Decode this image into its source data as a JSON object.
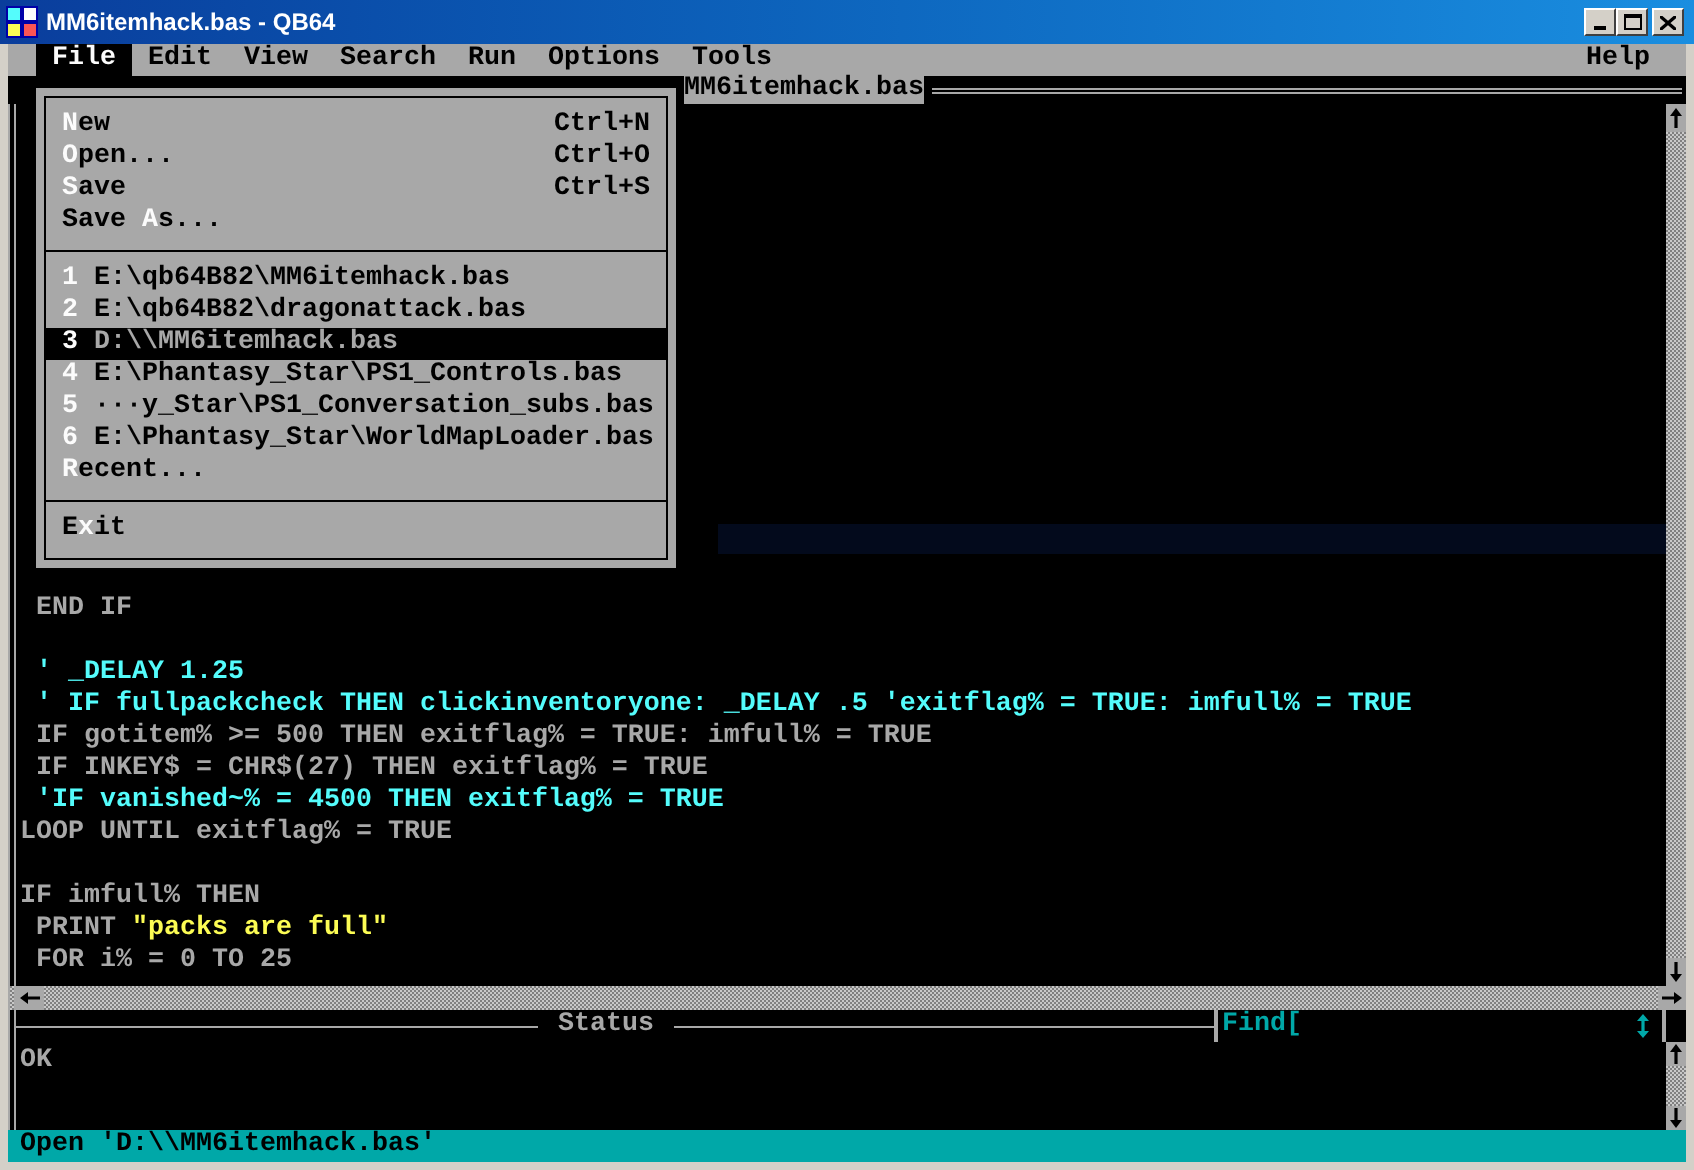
{
  "window": {
    "title": "MM6itemhack.bas - QB64"
  },
  "menu_bar": [
    {
      "label": "File",
      "selected": true
    },
    {
      "label": "Edit",
      "selected": false
    },
    {
      "label": "View",
      "selected": false
    },
    {
      "label": "Search",
      "selected": false
    },
    {
      "label": "Run",
      "selected": false
    },
    {
      "label": "Options",
      "selected": false
    },
    {
      "label": "Tools",
      "selected": false
    },
    {
      "label": "Help",
      "selected": false
    }
  ],
  "file_menu": {
    "sections": [
      {
        "items": [
          {
            "hotkey": "N",
            "rest": "ew",
            "shortcut": "Ctrl+N",
            "selected": false
          },
          {
            "hotkey": "O",
            "rest": "pen...",
            "shortcut": "Ctrl+O",
            "selected": false
          },
          {
            "hotkey": "S",
            "rest": "ave",
            "shortcut": "Ctrl+S",
            "selected": false
          },
          {
            "before": "Save ",
            "hotkey": "A",
            "rest": "s...",
            "selected": false
          }
        ]
      },
      {
        "items": [
          {
            "hotkey": "1",
            "rest": " E:\\qb64B82\\MM6itemhack.bas",
            "selected": false
          },
          {
            "hotkey": "2",
            "rest": " E:\\qb64B82\\dragonattack.bas",
            "selected": false
          },
          {
            "hotkey": "3",
            "rest": " D:\\\\MM6itemhack.bas",
            "selected": true
          },
          {
            "hotkey": "4",
            "rest": " E:\\Phantasy_Star\\PS1_Controls.bas",
            "selected": false
          },
          {
            "hotkey": "5",
            "rest": " ···y_Star\\PS1_Conversation_subs.bas",
            "selected": false
          },
          {
            "hotkey": "6",
            "rest": " E:\\Phantasy_Star\\WorldMapLoader.bas",
            "selected": false
          },
          {
            "hotkey": "R",
            "rest": "ecent...",
            "selected": false
          }
        ]
      },
      {
        "items": [
          {
            "before": "E",
            "hotkey": "x",
            "rest": "it",
            "selected": false
          }
        ]
      }
    ]
  },
  "editor": {
    "tab_title": "MM6itemhack.bas",
    "lines": [
      {
        "kind": "text",
        "segments": [
          {
            "kind": "code",
            "text": " END IF"
          }
        ]
      },
      {
        "kind": "blank"
      },
      {
        "kind": "text",
        "segments": [
          {
            "kind": "comment",
            "text": " ' _DELAY 1.25"
          }
        ]
      },
      {
        "kind": "text",
        "segments": [
          {
            "kind": "comment",
            "text": " ' IF fullpackcheck THEN clickinventoryone: _DELAY .5 'exitflag% = TRUE: imfull% = TRUE"
          }
        ]
      },
      {
        "kind": "text",
        "segments": [
          {
            "kind": "code",
            "text": " IF gotitem% >= 500 THEN exitflag% = TRUE: imfull% = TRUE"
          }
        ]
      },
      {
        "kind": "text",
        "segments": [
          {
            "kind": "code",
            "text": " IF INKEY$ = CHR$(27) THEN exitflag% = TRUE"
          }
        ]
      },
      {
        "kind": "text",
        "segments": [
          {
            "kind": "comment",
            "text": " 'IF vanished~% = 4500 THEN exitflag% = TRUE"
          }
        ]
      },
      {
        "kind": "text",
        "segments": [
          {
            "kind": "code",
            "text": "LOOP UNTIL exitflag% = TRUE"
          }
        ]
      },
      {
        "kind": "blank"
      },
      {
        "kind": "text",
        "segments": [
          {
            "kind": "code",
            "text": "IF imfull% THEN"
          }
        ]
      },
      {
        "kind": "text",
        "segments": [
          {
            "kind": "code",
            "text": " PRINT "
          },
          {
            "kind": "string",
            "text": "\"packs are full\""
          }
        ]
      },
      {
        "kind": "text",
        "segments": [
          {
            "kind": "code",
            "text": " FOR i% = 0 TO 25"
          }
        ]
      }
    ]
  },
  "status": {
    "title": "Status",
    "find_label": "Find[",
    "message": "OK"
  },
  "status_bar": {
    "text": "Open 'D:\\\\MM6itemhack.bas'"
  }
}
